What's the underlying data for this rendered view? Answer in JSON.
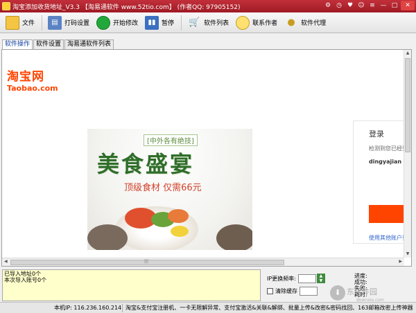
{
  "window": {
    "title": "淘宝添加收货地址_V3.3 【淘易通软件 www.52tio.com】 (作者QQ: 97905152)",
    "controls": [
      "⚙",
      "◷",
      "♥",
      "☺",
      "≡",
      "—",
      "□",
      "✕"
    ]
  },
  "toolbar": {
    "file_label": "文件",
    "print_label": "打码设置",
    "start_label": "开始修改",
    "pause_label": "暂停",
    "software_list_label": "软件列表",
    "contact_label": "联系作者",
    "agent_label": "软件代理"
  },
  "tabs": [
    "软件操作",
    "软件设置",
    "淘易通软件列表"
  ],
  "browser": {
    "logo_cn": "淘宝网",
    "logo_en": "Taobao.com",
    "ad": {
      "tagline": "[中外各有绝技]",
      "headline": "美食盛宴",
      "subline": "顶级食材  仅需66元"
    },
    "login": {
      "title": "登录",
      "hint": "检测到您已经登",
      "username": "dingyajian",
      "other_link": "使用其他账户登"
    },
    "hscroll_grip": "|||"
  },
  "log": {
    "line1": "已导入地址0个",
    "line2": "本次导入账号0个"
  },
  "controls": {
    "ip_freq_label": "IP更换频率:",
    "clear_cache_label": "清除缓存"
  },
  "progress": {
    "progress_label": "进度:",
    "success_label": "成功:",
    "fail_label": "失败:",
    "time_label": "耗时:"
  },
  "watermark": {
    "text": "东软件园",
    "sub": "downxia.com"
  },
  "statusbar": {
    "ip": "本机IP: 116.236.160.214",
    "ad": "淘宝&支付宝注册机、一卡无限解异常、支付宝激活&关联&解绑、批量上传&改密&密码找回、163邮箱改密上传神器"
  }
}
